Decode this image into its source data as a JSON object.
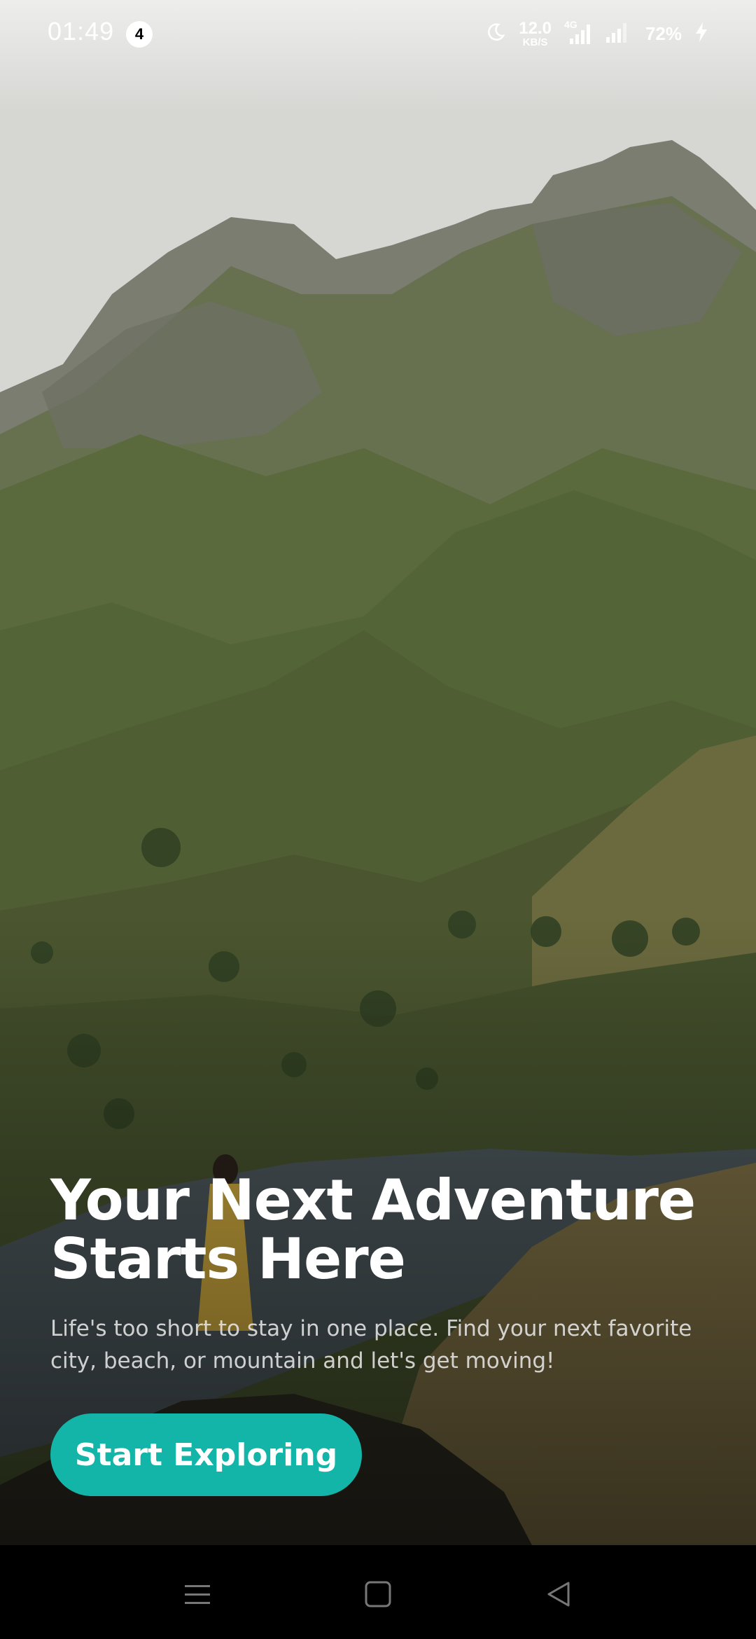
{
  "status_bar": {
    "time": "01:49",
    "notification_count": "4",
    "network_speed_value": "12.0",
    "network_speed_unit": "KB/S",
    "network_type": "4G",
    "battery": "72%"
  },
  "hero": {
    "headline": "Your Next Adventure Starts Here",
    "subtext": "Life's too short to stay in one place. Find your next favorite city, beach, or mountain and let's get moving!",
    "cta_label": "Start Exploring"
  },
  "colors": {
    "accent": "#12b5a7",
    "text": "#ffffff",
    "nav_background": "#000000"
  },
  "icons": {
    "status": [
      "moon-icon",
      "signal-4g-icon",
      "signal-icon",
      "charging-bolt-icon"
    ],
    "nav": [
      "menu-icon",
      "home-square-icon",
      "back-triangle-icon"
    ]
  }
}
